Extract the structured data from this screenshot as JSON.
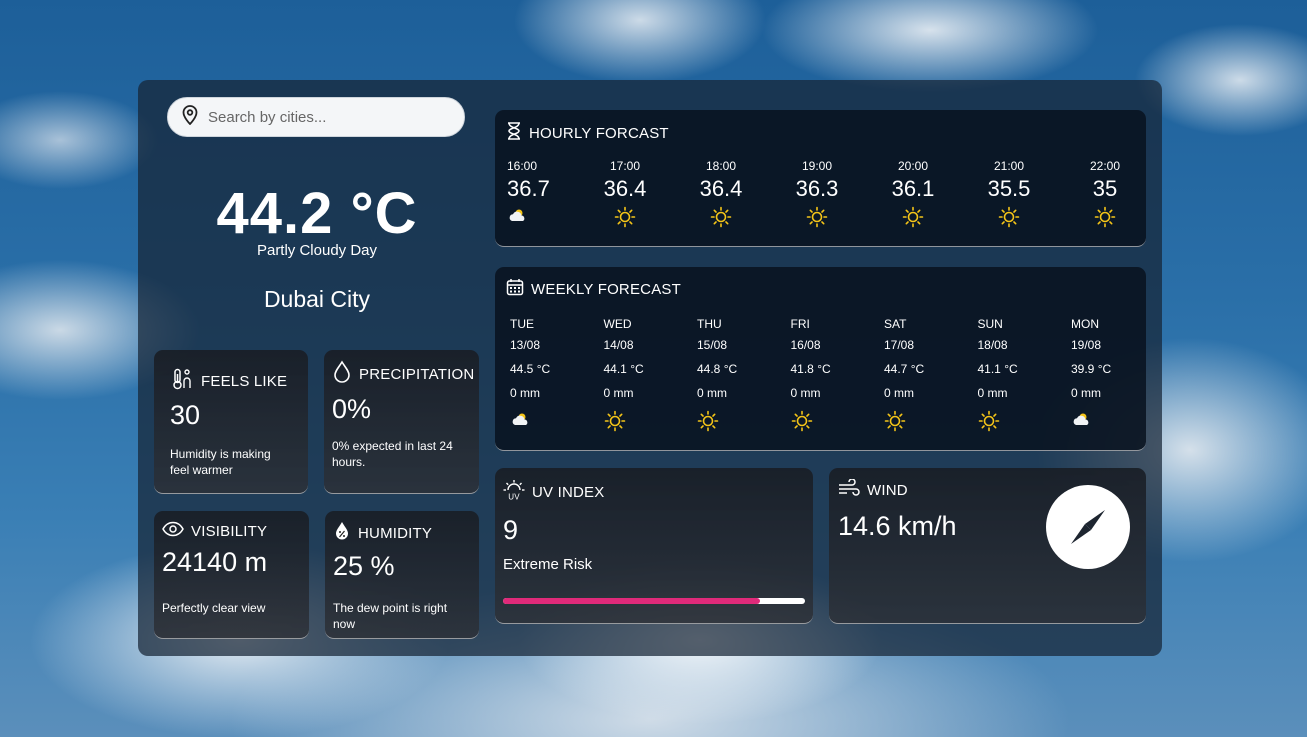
{
  "search": {
    "placeholder": "Search by cities..."
  },
  "current": {
    "temperature": "44.2 °C",
    "condition": "Partly Cloudy Day",
    "city": "Dubai City"
  },
  "feels_like": {
    "title": "FEELS LIKE",
    "value": "30",
    "note": "Humidity is making feel warmer",
    "icon": "thermometer-icon"
  },
  "precipitation": {
    "title": "PRECIPITATION",
    "value": "0%",
    "note": "0% expected in last 24 hours.",
    "icon": "droplet-icon"
  },
  "visibility": {
    "title": "VISIBILITY",
    "value": "24140 m",
    "note": "Perfectly clear view",
    "icon": "eye-icon"
  },
  "humidity": {
    "title": "HUMIDITY",
    "value": "25 %",
    "note": "The dew point is right now",
    "icon": "percent-drop-icon"
  },
  "hourly": {
    "title": "HOURLY FORCAST",
    "items": [
      {
        "time": "16:00",
        "temp": "36.7",
        "icon": "partly-cloudy-icon"
      },
      {
        "time": "17:00",
        "temp": "36.4",
        "icon": "sun-icon"
      },
      {
        "time": "18:00",
        "temp": "36.4",
        "icon": "sun-icon"
      },
      {
        "time": "19:00",
        "temp": "36.3",
        "icon": "sun-icon"
      },
      {
        "time": "20:00",
        "temp": "36.1",
        "icon": "sun-icon"
      },
      {
        "time": "21:00",
        "temp": "35.5",
        "icon": "sun-icon"
      },
      {
        "time": "22:00",
        "temp": "35",
        "icon": "sun-icon"
      }
    ]
  },
  "weekly": {
    "title": "WEEKLY FORECAST",
    "days": [
      {
        "day": "TUE",
        "date": "13/08",
        "temp": "44.5 °C",
        "precip": "0 mm",
        "icon": "partly-cloudy-icon"
      },
      {
        "day": "WED",
        "date": "14/08",
        "temp": "44.1 °C",
        "precip": "0 mm",
        "icon": "sun-icon"
      },
      {
        "day": "THU",
        "date": "15/08",
        "temp": "44.8 °C",
        "precip": "0 mm",
        "icon": "sun-icon"
      },
      {
        "day": "FRI",
        "date": "16/08",
        "temp": "41.8 °C",
        "precip": "0 mm",
        "icon": "sun-icon"
      },
      {
        "day": "SAT",
        "date": "17/08",
        "temp": "44.7 °C",
        "precip": "0 mm",
        "icon": "sun-icon"
      },
      {
        "day": "SUN",
        "date": "18/08",
        "temp": "41.1 °C",
        "precip": "0 mm",
        "icon": "sun-icon"
      },
      {
        "day": "MON",
        "date": "19/08",
        "temp": "39.9 °C",
        "precip": "0 mm",
        "icon": "partly-cloudy-icon"
      }
    ]
  },
  "uv": {
    "title": "UV INDEX",
    "value": "9",
    "risk": "Extreme Risk",
    "level_fraction": 0.85,
    "bar_color": "#e02a7a"
  },
  "wind": {
    "title": "WIND",
    "speed": "14.6 km/h",
    "icon": "compass-icon"
  }
}
